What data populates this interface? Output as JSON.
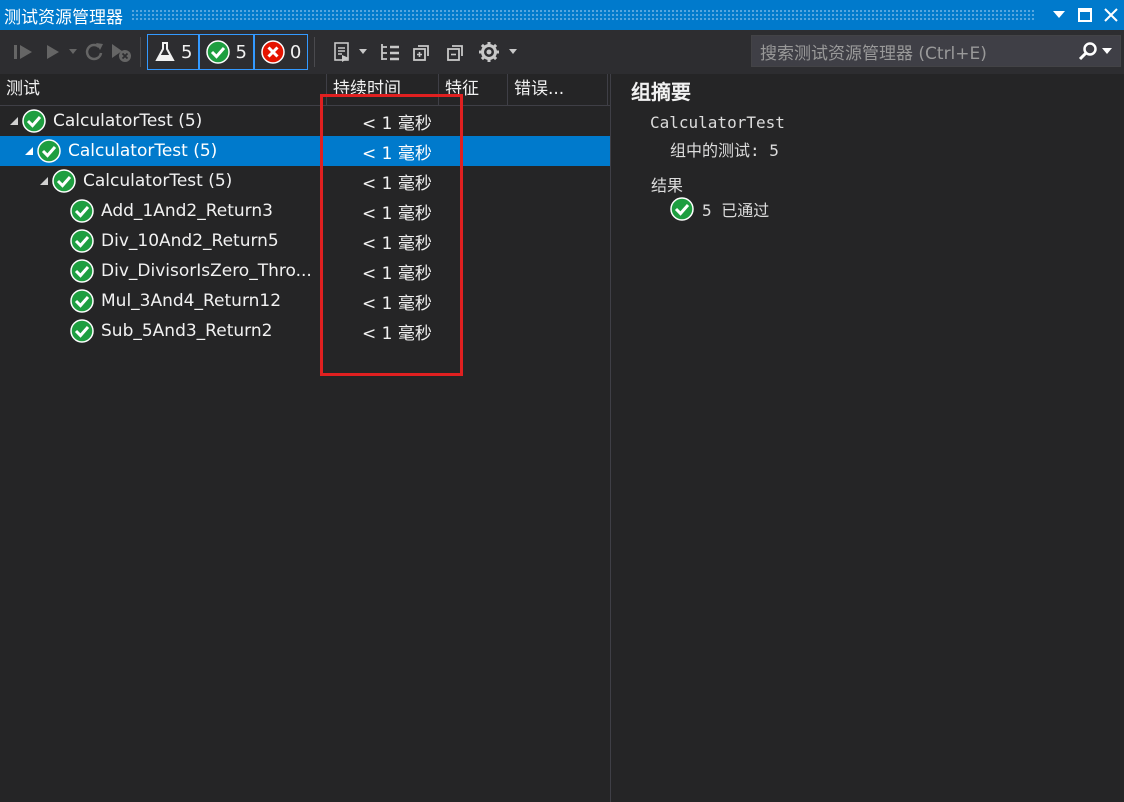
{
  "titlebar": {
    "title": "测试资源管理器"
  },
  "toolbar": {
    "filters": [
      {
        "icon": "flask-icon",
        "count": "5"
      },
      {
        "icon": "passed-check-icon",
        "count": "5"
      },
      {
        "icon": "failed-x-icon",
        "count": "0"
      }
    ],
    "search_placeholder": "搜索测试资源管理器 (Ctrl+E)"
  },
  "columns": {
    "test": "测试",
    "duration": "持续时间",
    "traits": "特征",
    "error": "错误..."
  },
  "tree": [
    {
      "name": "CalculatorTest  (5)",
      "duration": "< 1 毫秒",
      "level": 0,
      "expander": true,
      "selected": false
    },
    {
      "name": "CalculatorTest  (5)",
      "duration": "< 1 毫秒",
      "level": 1,
      "expander": true,
      "selected": true
    },
    {
      "name": "CalculatorTest  (5)",
      "duration": "< 1 毫秒",
      "level": 2,
      "expander": true,
      "selected": false
    },
    {
      "name": "Add_1And2_Return3",
      "duration": "< 1 毫秒",
      "level": 3,
      "expander": false,
      "selected": false
    },
    {
      "name": "Div_10And2_Return5",
      "duration": "< 1 毫秒",
      "level": 3,
      "expander": false,
      "selected": false
    },
    {
      "name": "Div_DivisorIsZero_Thro...",
      "duration": "< 1 毫秒",
      "level": 3,
      "expander": false,
      "selected": false
    },
    {
      "name": "Mul_3And4_Return12",
      "duration": "< 1 毫秒",
      "level": 3,
      "expander": false,
      "selected": false
    },
    {
      "name": "Sub_5And3_Return2",
      "duration": "< 1 毫秒",
      "level": 3,
      "expander": false,
      "selected": false
    }
  ],
  "summary": {
    "heading": "组摘要",
    "group_name": "CalculatorTest",
    "tests_in_group": "组中的测试: 5",
    "results_label": "结果",
    "passed": "5 已通过"
  },
  "colors": {
    "accent": "#007acc",
    "pass": "#1e9e40",
    "fail": "#e51400",
    "highlight": "#e02020"
  }
}
